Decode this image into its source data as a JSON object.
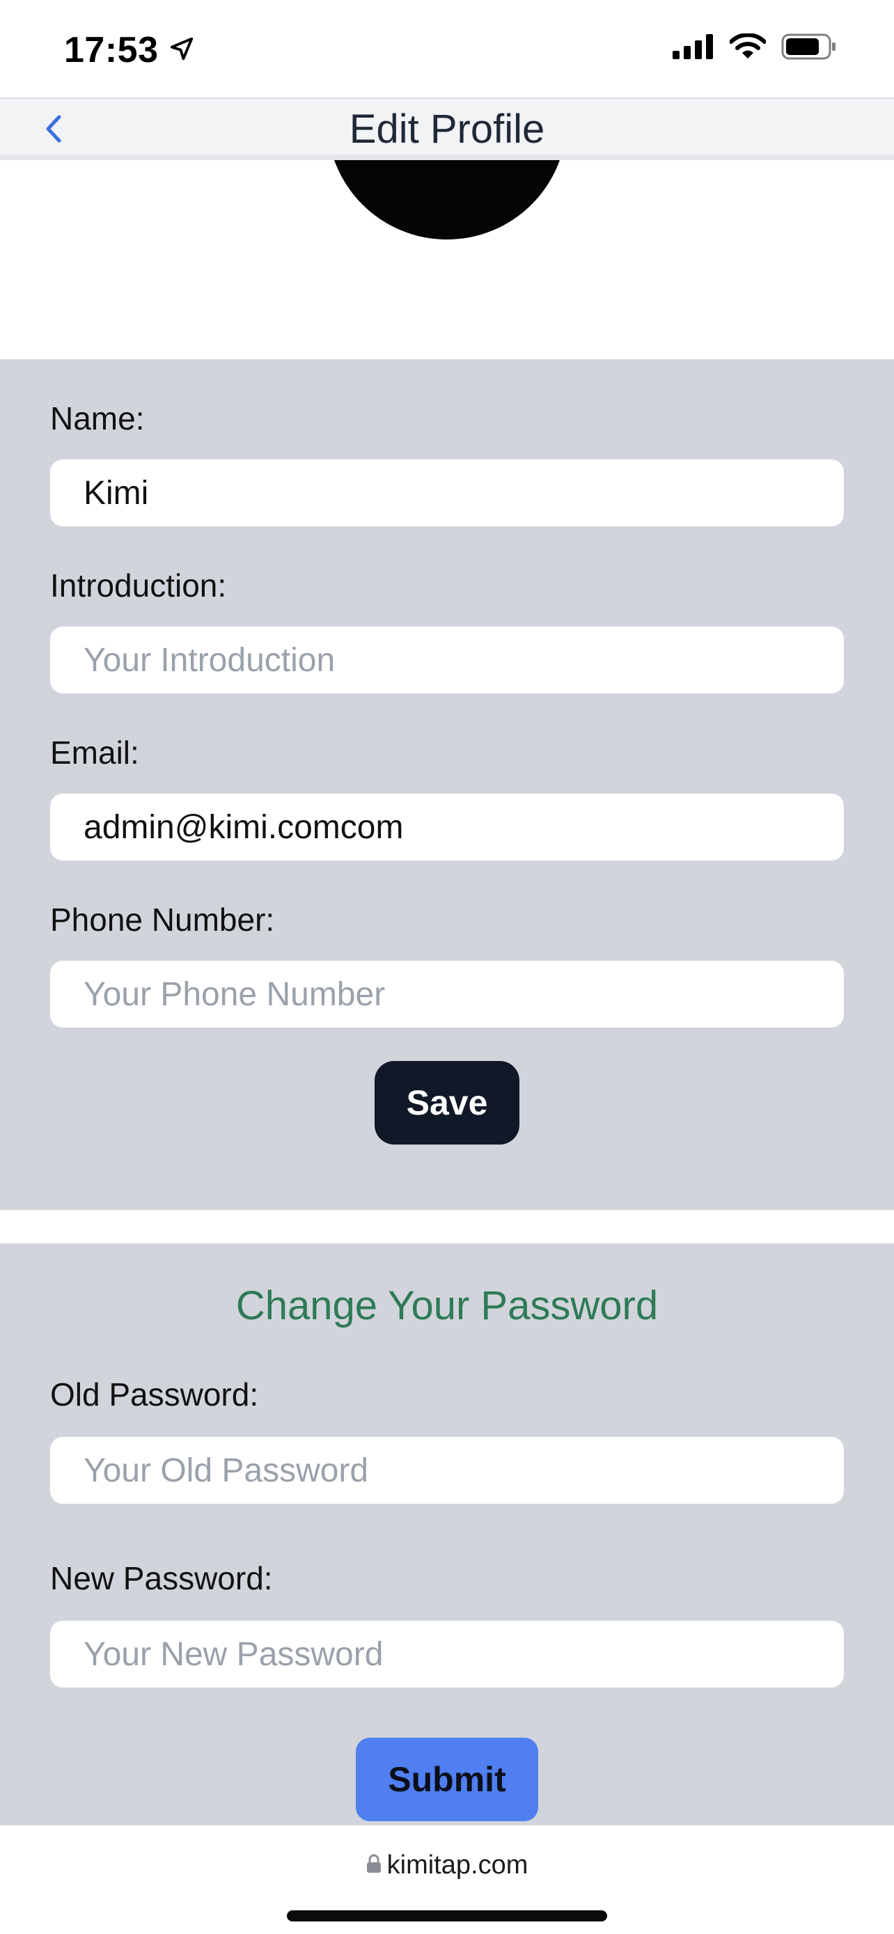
{
  "status_bar": {
    "time": "17:53",
    "icons": [
      "location-arrow-icon",
      "cellular-signal-icon",
      "wifi-icon",
      "battery-icon"
    ]
  },
  "header": {
    "title": "Edit Profile",
    "back_icon": "chevron-left-icon"
  },
  "profile_form": {
    "name": {
      "label": "Name:",
      "value": "Kimi",
      "placeholder": ""
    },
    "introduction": {
      "label": "Introduction:",
      "value": "",
      "placeholder": "Your Introduction"
    },
    "email": {
      "label": "Email:",
      "value": "admin@kimi.comcom",
      "placeholder": ""
    },
    "phone": {
      "label": "Phone Number:",
      "value": "",
      "placeholder": "Your Phone Number"
    },
    "save_label": "Save"
  },
  "password_form": {
    "title": "Change Your Password",
    "old_password": {
      "label": "Old Password:",
      "placeholder": "Your Old Password"
    },
    "new_password": {
      "label": "New Password:",
      "placeholder": "Your New Password"
    },
    "submit_label": "Submit"
  },
  "browser": {
    "url": "kimitap.com",
    "lock_icon": "lock-icon"
  },
  "colors": {
    "panel_bg": "#d1d5db",
    "save_button": "#111827",
    "submit_button": "#4f7ff0",
    "section_title": "#2f7a57",
    "back_icon": "#3b6fe0"
  }
}
